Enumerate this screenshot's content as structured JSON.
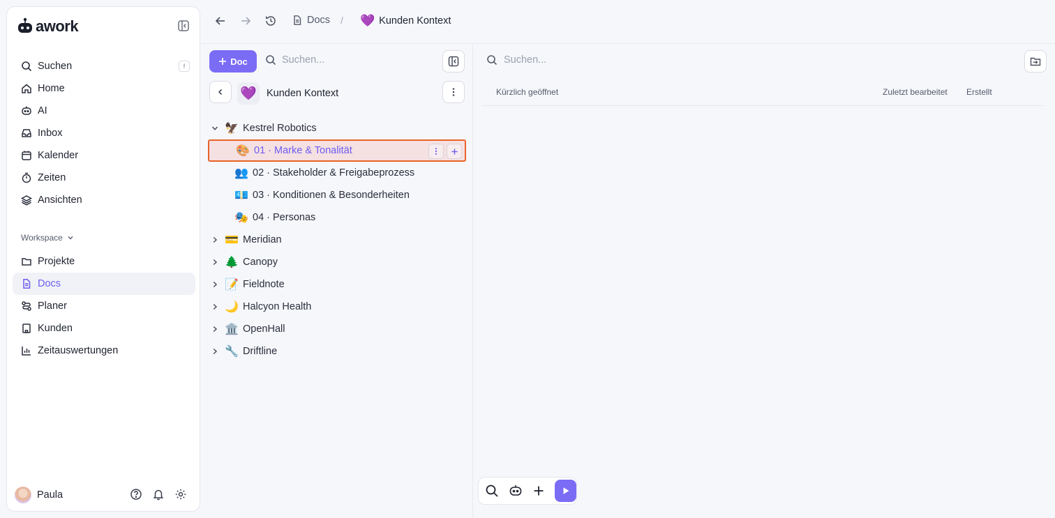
{
  "app": {
    "logo_text": "awork"
  },
  "sidebar": {
    "nav": [
      {
        "label": "Suchen",
        "shortcut": "f"
      },
      {
        "label": "Home"
      },
      {
        "label": "AI"
      },
      {
        "label": "Inbox"
      },
      {
        "label": "Kalender"
      },
      {
        "label": "Zeiten"
      },
      {
        "label": "Ansichten"
      }
    ],
    "workspace_label": "Workspace",
    "workspace_nav": [
      {
        "label": "Projekte"
      },
      {
        "label": "Docs",
        "active": true
      },
      {
        "label": "Planer"
      },
      {
        "label": "Kunden"
      },
      {
        "label": "Zeitauswertungen"
      }
    ],
    "user_name": "Paula"
  },
  "header": {
    "breadcrumb": [
      {
        "label": "Docs"
      },
      {
        "label": "Kunden Kontext",
        "emoji": "💜"
      }
    ],
    "separator": "/"
  },
  "tree_panel": {
    "new_doc_label": "Doc",
    "search_placeholder": "Suchen...",
    "folder": {
      "emoji": "💜",
      "title": "Kunden Kontext"
    },
    "items": [
      {
        "emoji": "🦅",
        "label": "Kestrel Robotics",
        "expanded": true,
        "children": [
          {
            "emoji": "🎨",
            "label": "01 · Marke & Tonalität",
            "selected": true
          },
          {
            "emoji": "👥",
            "label": "02 · Stakeholder & Freigabeprozess"
          },
          {
            "emoji": "💶",
            "label": "03 · Konditionen & Besonderheiten"
          },
          {
            "emoji": "🎭",
            "label": "04 · Personas"
          }
        ]
      },
      {
        "emoji": "💳",
        "label": "Meridian"
      },
      {
        "emoji": "🌲",
        "label": "Canopy"
      },
      {
        "emoji": "📝",
        "label": "Fieldnote"
      },
      {
        "emoji": "🌙",
        "label": "Halcyon Health"
      },
      {
        "emoji": "🏛️",
        "label": "OpenHall"
      },
      {
        "emoji": "🔧",
        "label": "Driftline"
      }
    ]
  },
  "main": {
    "search_placeholder": "Suchen...",
    "columns": {
      "recent": "Kürzlich geöffnet",
      "edited": "Zuletzt bearbeitet",
      "created": "Erstellt"
    }
  }
}
